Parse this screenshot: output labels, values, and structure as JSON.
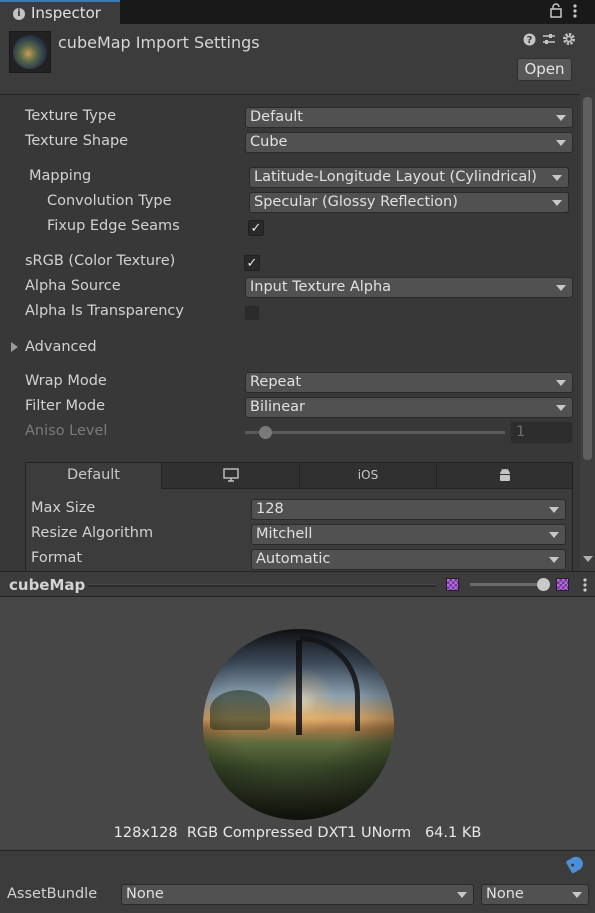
{
  "window": {
    "tab_title": "Inspector"
  },
  "header": {
    "title": "cubeMap Import Settings",
    "open_button": "Open"
  },
  "settings": {
    "texture_type": {
      "label": "Texture Type",
      "value": "Default"
    },
    "texture_shape": {
      "label": "Texture Shape",
      "value": "Cube"
    },
    "mapping": {
      "label": "Mapping",
      "value": "Latitude-Longitude Layout (Cylindrical)"
    },
    "convolution_type": {
      "label": "Convolution Type",
      "value": "Specular (Glossy Reflection)"
    },
    "fixup_edge_seams": {
      "label": "Fixup Edge Seams",
      "checked": true
    },
    "srgb": {
      "label": "sRGB (Color Texture)",
      "checked": true
    },
    "alpha_source": {
      "label": "Alpha Source",
      "value": "Input Texture Alpha"
    },
    "alpha_is_transparency": {
      "label": "Alpha Is Transparency",
      "checked": false
    },
    "advanced": {
      "label": "Advanced",
      "expanded": false
    },
    "wrap_mode": {
      "label": "Wrap Mode",
      "value": "Repeat"
    },
    "filter_mode": {
      "label": "Filter Mode",
      "value": "Bilinear"
    },
    "aniso_level": {
      "label": "Aniso Level",
      "value": "1",
      "slider_fraction": 0.06
    }
  },
  "platform_tabs": {
    "default_label": "Default",
    "standalone_icon": "monitor-icon",
    "ios_label": "iOS",
    "android_icon": "android-icon",
    "active": "Default"
  },
  "platform_settings": {
    "max_size": {
      "label": "Max Size",
      "value": "128"
    },
    "resize_algorithm": {
      "label": "Resize Algorithm",
      "value": "Mitchell"
    },
    "format": {
      "label": "Format",
      "value": "Automatic"
    }
  },
  "preview": {
    "title": "cubeMap",
    "info": "128x128  RGB Compressed DXT1 UNorm   64.1 KB",
    "mip_slider_fraction": 0.95
  },
  "asset_bundle": {
    "label": "AssetBundle",
    "name_value": "None",
    "variant_value": "None"
  },
  "colors": {
    "background": "#383838",
    "accent": "#3a79bb",
    "tag": "#4a8fd8"
  }
}
